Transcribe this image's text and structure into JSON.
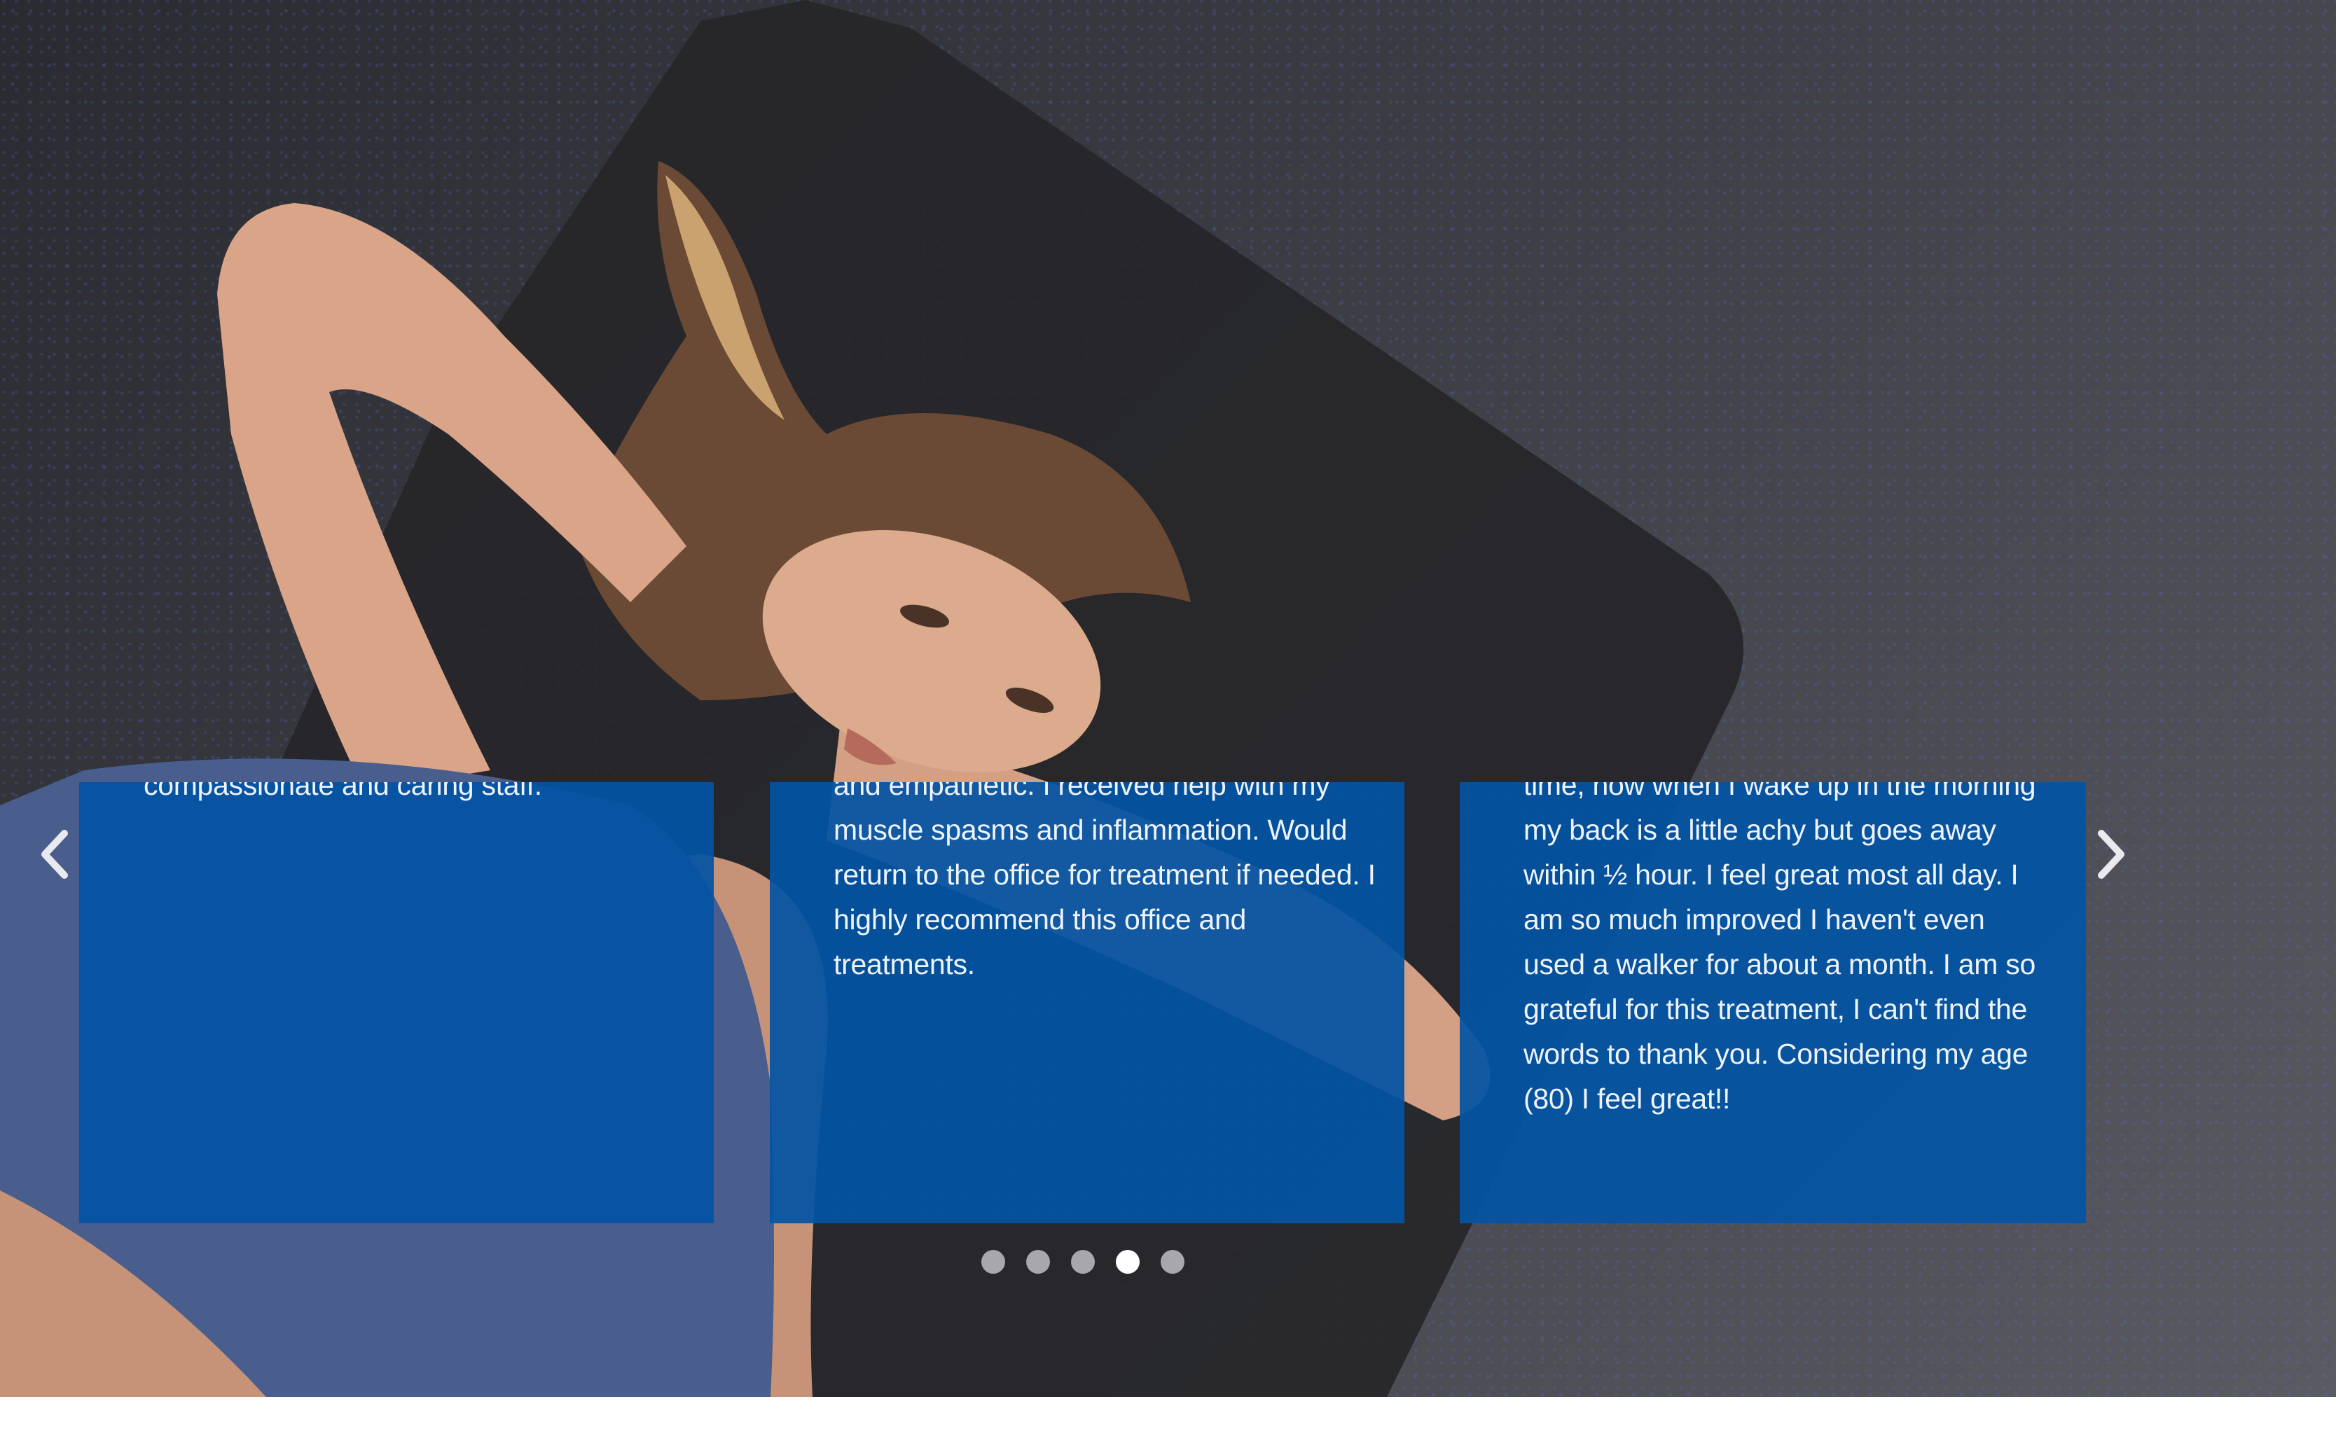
{
  "carousel": {
    "prev_icon": "chevron-left-icon",
    "next_icon": "chevron-right-icon",
    "testimonials": [
      {
        "text": "compassionate and caring staff."
      },
      {
        "text": "and empathetic. I received help with my muscle spasms and inflammation. Would return to the office for treatment if needed. I highly recommend this office and treatments."
      },
      {
        "text": "time, now when I wake up in the morning my back is a little achy but goes away within ½ hour. I feel great most all day. I am so much improved I haven't even used a walker for about a month. I am so grateful for this treatment, I can't find the words to thank you. Considering my age (80) I feel great!!"
      }
    ],
    "pagination": {
      "total": 5,
      "active_index": 3
    },
    "card_color": "#0354A4"
  }
}
